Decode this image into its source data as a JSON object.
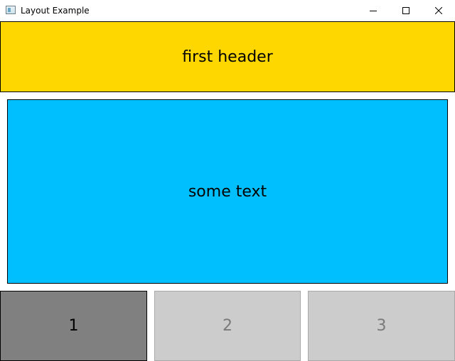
{
  "window": {
    "title": "Layout Example",
    "app_icon": "window-app-icon",
    "controls": {
      "minimize_icon": "minimize-icon",
      "maximize_icon": "maximize-icon",
      "close_icon": "close-icon"
    }
  },
  "header": {
    "text": "first header",
    "color": "#ffd700"
  },
  "main": {
    "text": "some text",
    "color": "#00bfff"
  },
  "tabs": [
    {
      "label": "1",
      "state": "selected",
      "color": "#808080"
    },
    {
      "label": "2",
      "state": "disabled",
      "color": "#cccccc"
    },
    {
      "label": "3",
      "state": "disabled",
      "color": "#cccccc"
    }
  ]
}
